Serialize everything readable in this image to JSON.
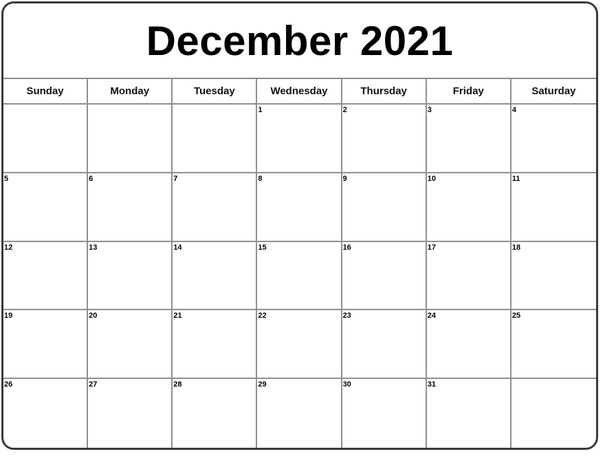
{
  "title": "December 2021",
  "weekdays": [
    "Sunday",
    "Monday",
    "Tuesday",
    "Wednesday",
    "Thursday",
    "Friday",
    "Saturday"
  ],
  "weeks": [
    [
      "",
      "",
      "",
      "1",
      "2",
      "3",
      "4"
    ],
    [
      "5",
      "6",
      "7",
      "8",
      "9",
      "10",
      "11"
    ],
    [
      "12",
      "13",
      "14",
      "15",
      "16",
      "17",
      "18"
    ],
    [
      "19",
      "20",
      "21",
      "22",
      "23",
      "24",
      "25"
    ],
    [
      "26",
      "27",
      "28",
      "29",
      "30",
      "31",
      ""
    ]
  ]
}
